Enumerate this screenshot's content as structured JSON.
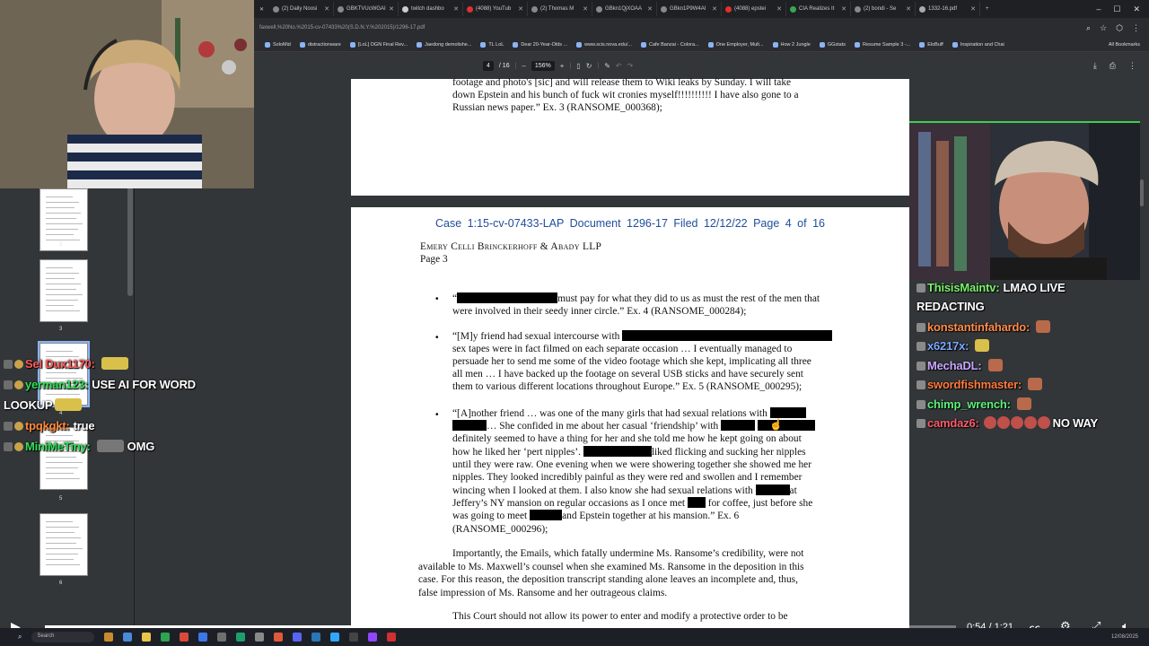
{
  "browser": {
    "tabs": [
      {
        "label": "(2) Daily Noosi",
        "color": "#888"
      },
      {
        "label": "GBKTVUcWGAI",
        "color": "#888"
      },
      {
        "label": "twitch dashbo",
        "color": "#ccc"
      },
      {
        "label": "(4088) YouTub",
        "color": "#e03030"
      },
      {
        "label": "(2) Thomas M",
        "color": "#888"
      },
      {
        "label": "GBkn1QjXOAA",
        "color": "#888"
      },
      {
        "label": "GBkn1P9W4AI",
        "color": "#888"
      },
      {
        "label": "(4088) epstei",
        "color": "#e03030"
      },
      {
        "label": "CIA Realizes It",
        "color": "#3aa655"
      },
      {
        "label": "(2) bondi - Se",
        "color": "#888"
      },
      {
        "label": "1332-16.pdf",
        "color": "#aaa"
      }
    ],
    "url": "faxwell,%20No.%2015-cv-07433%20(S.D.N.Y.%202015)/1296-17.pdf",
    "bookmarks": [
      "SoloMid",
      "distractionware",
      "[LoL] OGN Final Rev...",
      "Jaedong demolishe...",
      "TL LoL",
      "Dear 20-Year-Olds ...",
      "www.scis.nova.edu/...",
      "Cafe Banzai - Colora...",
      "One Employer, Mult...",
      "How 2 Jungle",
      "GGstats",
      "Resume Sample 3 -...",
      "EloBuff",
      "Inspiration and Chai"
    ],
    "all_bookmarks": "All Bookmarks"
  },
  "pdf": {
    "page_input": "4",
    "page_total": "/ 16",
    "zoom": "156%",
    "prev_page_lines": [
      "footage and photo's [sic] and will release them to Wiki leaks by Sunday. I will take",
      "down Epstein and his bunch of fuck wit cronies myself!!!!!!!!!! I have also gone to a",
      "Russian news paper.” Ex. 3 (RANSOME_000368);"
    ],
    "case_header": "Case 1:15-cv-07433-LAP    Document 1296-17    Filed 12/12/22    Page 4 of 16",
    "firm": "Emery Celli Brinckerhoff & Abady LLP",
    "page_label": "Page 3",
    "b1_l1": "must pay for what they did to us as must the rest of the men that",
    "b1_l2": "were involved in their seedy inner circle.” Ex. 4 (RANSOME_000284);",
    "b2_l1": "“[M]y friend had sexual intercourse with",
    "b2_rest": [
      "sex tapes were in fact filmed on each separate occasion … I eventually managed to",
      "persuade her to send me some of the video footage which she kept, implicating all three",
      "all men … I have backed up the footage on several USB sticks and have securely sent",
      "them to various different locations throughout Europe.” Ex. 5 (RANSOME_000295);"
    ],
    "b3_l1": "“[A]nother friend … was one of the many girls that had sexual relations with",
    "b3_l2": "… She confided in me about her casual ‘friendship’ with",
    "b3_l3": "definitely seemed to have a thing for her and she told me how he kept going on about",
    "b3_l4": "how he liked her ‘pert nipples’.",
    "b3_l4b": "liked flicking and sucking her nipples",
    "b3_mid": [
      "until they were raw. One evening when we were showering together she showed me her",
      "nipples. They looked incredibly painful as they were red and swollen and I remember"
    ],
    "b3_l7": "wincing when I looked at them. I also know she had sexual relations with",
    "b3_l7b": "at",
    "b3_l8": "Jeffery’s NY mansion on regular occasions as I once met",
    "b3_l8b": "for coffee, just before she",
    "b3_l9": "was going to meet",
    "b3_l9b": "and Epstein together at his mansion.” Ex. 6",
    "b3_l10": "(RANSOME_000296);",
    "para1": [
      "Importantly, the Emails, which fatally undermine Ms. Ransome’s credibility, were not",
      "available to Ms. Maxwell’s counsel when she examined Ms. Ransome in the deposition in this",
      "case.  For this reason, the deposition transcript standing alone leaves an incomplete and, thus,",
      "false impression of Ms. Ransome and her outrageous claims."
    ],
    "para2": "This Court should not allow its power to enter and modify a protective order to be",
    "thumb_numbers": [
      "2",
      "3",
      "4",
      "5",
      "6"
    ]
  },
  "chat_left": [
    {
      "user": "Sel Dux1170:",
      "msg": "",
      "color": "#ff5a5a"
    },
    {
      "user": "yerman123:",
      "msg": "USE AI FOR WORD",
      "color": "#33e05a"
    },
    {
      "user": "",
      "msg": "LOOKUP",
      "color": "#fff"
    },
    {
      "user": "tpqkgkt:",
      "msg": "true",
      "color": "#ff8a3d"
    },
    {
      "user": "MiniMeTiny:",
      "msg": "OMG",
      "color": "#33e05a"
    }
  ],
  "chat_right": [
    {
      "user": "ThisisMaintv:",
      "msg": "LMAO LIVE",
      "color": "#7cf06a"
    },
    {
      "user": "",
      "msg": "REDACTING",
      "color": "#fff"
    },
    {
      "user": "konstantinfahardo:",
      "msg": "",
      "color": "#ff8c4a"
    },
    {
      "user": "x6217x:",
      "msg": "",
      "color": "#7aa8ff"
    },
    {
      "user": "MechaDL:",
      "msg": "",
      "color": "#c9a8ff"
    },
    {
      "user": "swordfishmaster:",
      "msg": "",
      "color": "#ff7a3d"
    },
    {
      "user": "chimp_wrench:",
      "msg": "",
      "color": "#5ef07a"
    },
    {
      "user": "camdaz6:",
      "msg": "NO WAY",
      "color": "#ff5a6a"
    }
  ],
  "player": {
    "time": "0:54 / 1:21",
    "progress": 0.665
  },
  "taskbar": {
    "search": "Search",
    "tray": "12/08/2025"
  }
}
